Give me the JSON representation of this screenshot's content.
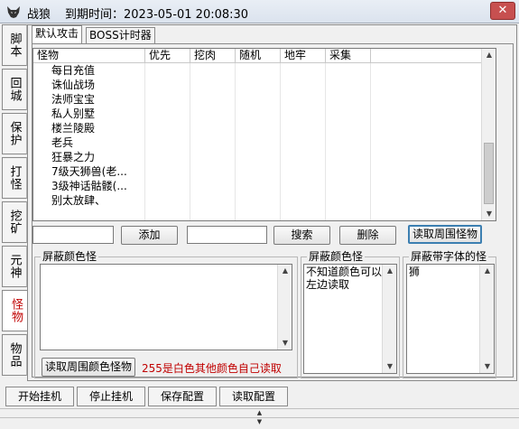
{
  "window": {
    "title": "战狼",
    "expiry": "到期时间：2023-05-01 20:08:30",
    "close_label": "✕"
  },
  "side_tabs": [
    {
      "label": "脚本"
    },
    {
      "label": "回城"
    },
    {
      "label": "保护"
    },
    {
      "label": "打怪"
    },
    {
      "label": "挖矿"
    },
    {
      "label": "元神"
    },
    {
      "label": "怪物"
    },
    {
      "label": "物品"
    }
  ],
  "top_tabs": [
    {
      "label": "默认攻击"
    },
    {
      "label": "BOSS计时器"
    }
  ],
  "monster_list": {
    "columns": [
      "怪物",
      "优先",
      "挖肉",
      "随机",
      "地牢",
      "采集"
    ],
    "rows": [
      "每日充值",
      "诛仙战场",
      "法师宝宝",
      "私人别墅",
      "楼兰陵殿",
      "老兵",
      "狂暴之力",
      "7级天狮兽(老...",
      "3级神话骷髅(...",
      "别太放肆、"
    ]
  },
  "controls": {
    "add_label": "添加",
    "search_label": "搜索",
    "delete_label": "删除",
    "read_nearby_label": "读取周围怪物"
  },
  "block_color_monster": {
    "group_label": "屏蔽颜色怪",
    "read_button": "读取周围颜色怪物",
    "hint": "255是白色其他颜色自己读取"
  },
  "block_color_monster2": {
    "group_label": "屏蔽颜色怪",
    "text": "不知道颜色可以左边读取"
  },
  "block_font_monster": {
    "group_label": "屏蔽带字体的怪",
    "text": "狮"
  },
  "bottom_buttons": [
    {
      "label": "开始挂机"
    },
    {
      "label": "停止挂机"
    },
    {
      "label": "保存配置"
    },
    {
      "label": "读取配置"
    }
  ],
  "colors": {
    "active_tab_text": "#c00000",
    "hint_text": "#c00000",
    "highlight_border": "#3c7fb1"
  }
}
